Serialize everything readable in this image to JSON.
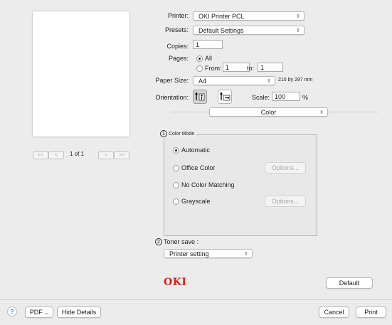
{
  "preview": {
    "page_indicator": "1 of 1",
    "first": "<<",
    "prev": "<",
    "next": ">",
    "last": ">>"
  },
  "printer": {
    "label": "Printer:",
    "value": "OKI Printer PCL"
  },
  "presets": {
    "label": "Presets:",
    "value": "Default Settings"
  },
  "copies": {
    "label": "Copies:",
    "value": "1"
  },
  "pages": {
    "label": "Pages:",
    "all_label": "All",
    "from_label": "From:",
    "from_value": "1",
    "to_label": "to:",
    "to_value": "1"
  },
  "paper": {
    "label": "Paper Size:",
    "value": "A4",
    "dimensions": "210 by 297 mm"
  },
  "orientation": {
    "label": "Orientation:",
    "portrait_icon": "portrait-orientation-icon",
    "landscape_icon": "landscape-orientation-icon"
  },
  "scale": {
    "label": "Scale:",
    "value": "100",
    "unit": "%"
  },
  "section": {
    "value": "Color"
  },
  "color_mode": {
    "marker": "1",
    "title": "Color Mode",
    "options": [
      {
        "label": "Automatic",
        "selected": true,
        "options_button": ""
      },
      {
        "label": "Office Color",
        "selected": false,
        "options_button": "Options..."
      },
      {
        "label": "No Color Matching",
        "selected": false,
        "options_button": ""
      },
      {
        "label": "Grayscale",
        "selected": false,
        "options_button": "Options..."
      }
    ]
  },
  "toner_save": {
    "marker": "2",
    "label": "Toner save :",
    "value": "Printer setting"
  },
  "logo": {
    "text": "OKI",
    "color": "#d8201a"
  },
  "buttons": {
    "default": "Default",
    "help": "?",
    "pdf": "PDF",
    "hide_details": "Hide Details",
    "cancel": "Cancel",
    "print": "Print"
  },
  "colors": {
    "background": "#ececec",
    "help_accent": "#3b7fdc"
  }
}
